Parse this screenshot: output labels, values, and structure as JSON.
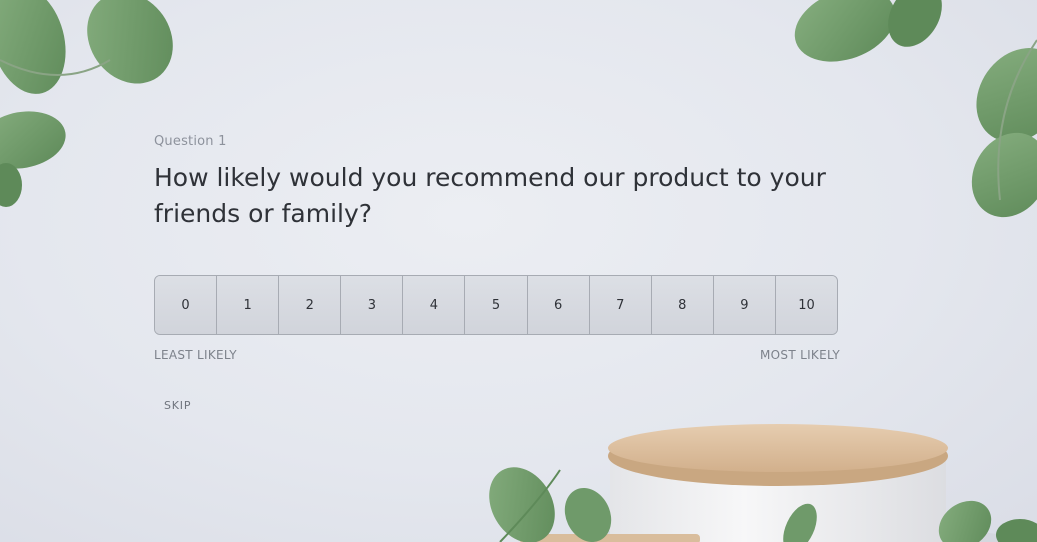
{
  "question": {
    "number_label": "Question 1",
    "text": "How likely would you recommend our product to your friends or family?"
  },
  "scale": {
    "options": [
      "0",
      "1",
      "2",
      "3",
      "4",
      "5",
      "6",
      "7",
      "8",
      "9",
      "10"
    ],
    "min_label": "LEAST LIKELY",
    "max_label": "MOST LIKELY"
  },
  "actions": {
    "skip_label": "SKIP"
  },
  "colors": {
    "leaf": "#6f9a6a",
    "leaf_dark": "#5d8758",
    "podium_top": "#dcc1a2",
    "podium_body": "#f3f3f4"
  }
}
